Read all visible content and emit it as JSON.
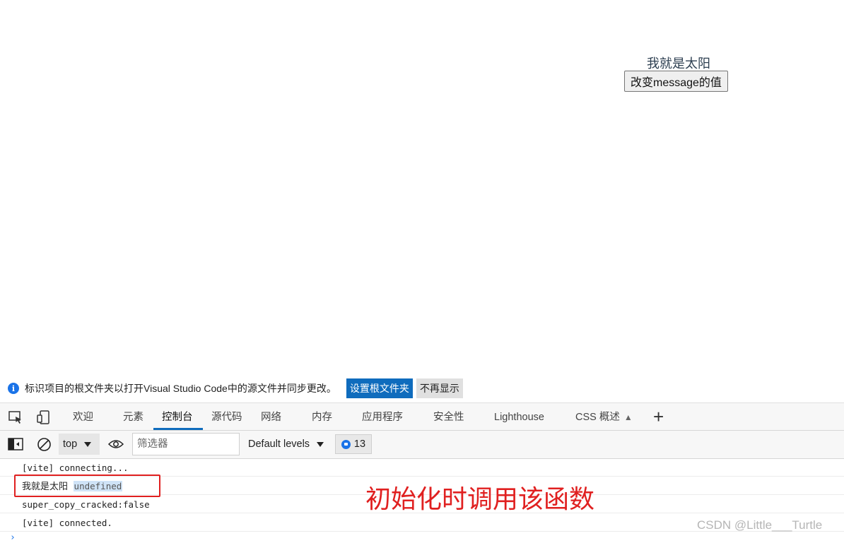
{
  "app": {
    "message": "我就是太阳",
    "button_label": "改变message的值"
  },
  "devtools": {
    "infobar": {
      "text": "标识项目的根文件夹以打开Visual Studio Code中的源文件并同步更改。",
      "primary_button": "设置根文件夹",
      "dismiss_button": "不再显示"
    },
    "tabs": [
      {
        "label": "欢迎"
      },
      {
        "label": "元素"
      },
      {
        "label": "控制台",
        "active": true
      },
      {
        "label": "源代码"
      },
      {
        "label": "网络"
      },
      {
        "label": "内存"
      },
      {
        "label": "应用程序"
      },
      {
        "label": "安全性"
      },
      {
        "label": "Lighthouse"
      },
      {
        "label": "CSS 概述"
      }
    ],
    "toolbar": {
      "context": "top",
      "filter_placeholder": "筛选器",
      "levels": "Default levels",
      "issues_count": "13"
    },
    "console": {
      "lines": [
        {
          "text": "[vite] connecting..."
        },
        {
          "text": "我就是太阳",
          "value": "undefined"
        },
        {
          "text": "super_copy_cracked:false"
        },
        {
          "text": "[vite] connected."
        }
      ]
    }
  },
  "annotation": {
    "text": "初始化时调用该函数",
    "color": "#e02020"
  },
  "watermark": "CSDN @Little___Turtle",
  "colors": {
    "accent": "#0f6cbd",
    "highlight_box": "#e02020"
  }
}
